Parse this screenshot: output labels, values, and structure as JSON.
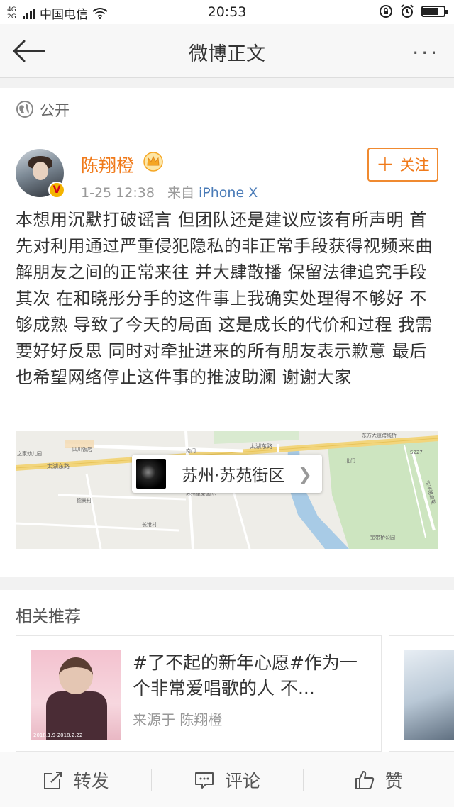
{
  "status_bar": {
    "network_type_top": "4G",
    "network_type_bottom": "2G",
    "carrier": "中国电信",
    "time": "20:53",
    "battery_level_percent": 70
  },
  "nav": {
    "title": "微博正文",
    "more_label": "···"
  },
  "visibility": {
    "label": "公开"
  },
  "post": {
    "username": "陈翔橙",
    "timestamp": "1-25 12:38",
    "source_prefix": "来自",
    "source": "iPhone X",
    "follow_label": "关注",
    "text": "本想用沉默打破谣言 但团队还是建议应该有所声明 首先对利用通过严重侵犯隐私的非正常手段获得视频来曲解朋友之间的正常来往 并大肆散播 保留法律追究手段 其次 在和晓彤分手的这件事上我确实处理得不够好 不够成熟 导致了今天的局面 这是成长的代价和过程 我需要好好反思 同时对牵扯进来的所有朋友表示歉意 最后 也希望网络停止这件事的推波助澜 谢谢大家",
    "location": "苏州·苏苑街区",
    "map_labels": {
      "road1": "太湖东路",
      "road2": "太湖东路",
      "road3": "东方大道跨线桥",
      "poi1": "之家幼儿园",
      "poi2": "四川饭店",
      "poi3": "南门",
      "poi4": "北门",
      "poi5": "S227",
      "poi6": "东环路高架",
      "poi7": "宝带桥公园",
      "poi8": "长港村",
      "poi9": "德景村",
      "poi10": "苏州童泰国际"
    }
  },
  "related": {
    "title": "相关推荐",
    "card": {
      "text": "#了不起的新年心愿#作为一个非常爱唱歌的人 不...",
      "source": "来源于 陈翔橙",
      "thumb_date": "2018.1.9-2018.2.22"
    }
  },
  "bottom_bar": {
    "repost": "转发",
    "comment": "评论",
    "like": "赞"
  },
  "colors": {
    "accent_orange": "#f07a1a",
    "link_blue": "#4a7bb7",
    "map_water": "#a8cbe6",
    "map_park": "#cde5c0"
  }
}
